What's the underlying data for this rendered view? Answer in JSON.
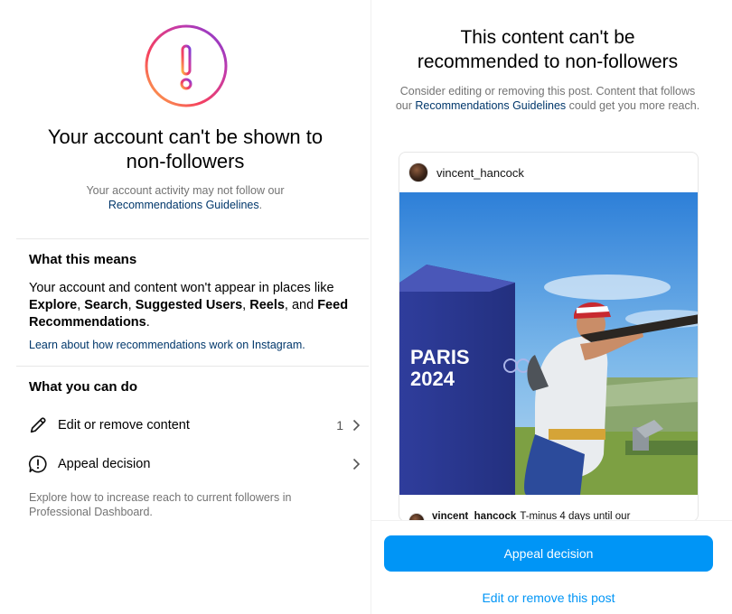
{
  "left": {
    "title_line1": "Your account can't be shown to",
    "title_line2": "non-followers",
    "sub_line1": "Your account activity may not follow our",
    "sub_link": "Recommendations Guidelines",
    "sub_period": ".",
    "what_means": {
      "heading": "What this means",
      "t1": "Your account and content won't appear in places like",
      "explore": "Explore",
      "c1": ", ",
      "search": "Search",
      "c2": ", ",
      "suggested": "Suggested Users",
      "c3": ", ",
      "reels": "Reels",
      "c4": ", and ",
      "feed": "Feed Recommendations",
      "end": ".",
      "learn_link": "Learn about how recommendations work on Instagram."
    },
    "what_do": {
      "heading": "What you can do",
      "edit_label": "Edit or remove content",
      "edit_count": "1",
      "appeal_label": "Appeal decision"
    },
    "explore_note": "Explore how to increase reach to current followers in Professional Dashboard."
  },
  "right": {
    "title_line1": "This content can't be",
    "title_line2": "recommended to non-followers",
    "sub_text1": "Consider editing or removing this post. Content that follows our",
    "sub_link": "Recommendations Guidelines",
    "sub_text2": "could get you more reach.",
    "post": {
      "username": "vincent_hancock",
      "photo_text1": "PARIS",
      "photo_text2": "2024",
      "caption_user": "vincent_hancock",
      "caption_text": "T-minus 4 days until our"
    },
    "appeal_button": "Appeal decision",
    "edit_link": "Edit or remove this post"
  },
  "colors": {
    "primary_blue": "#0095f6",
    "link_navy": "#00376b",
    "muted_gray": "#737373"
  },
  "icons": [
    "exclamation-ring-icon",
    "pencil-icon",
    "alert-circle-icon",
    "chevron-right-icon"
  ]
}
